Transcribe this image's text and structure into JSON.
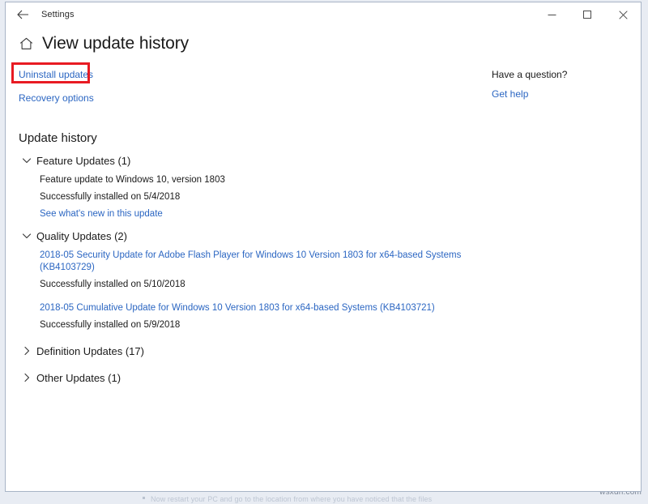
{
  "backdrop": {
    "cut_off_text": "Now restart your PC and go to the location from where you have noticed that the files",
    "watermark": "wsxdn.com"
  },
  "window": {
    "title": "Settings",
    "back_icon": "back-arrow-icon",
    "controls": {
      "minimize": "minimize-icon",
      "maximize": "maximize-icon",
      "close": "close-icon"
    }
  },
  "header": {
    "home_icon": "home-icon",
    "page_title": "View update history"
  },
  "actions": {
    "uninstall_updates": "Uninstall updates",
    "recovery_options": "Recovery options",
    "highlight_color": "#e81b23"
  },
  "help": {
    "heading": "Have a question?",
    "link": "Get help"
  },
  "update_history": {
    "section_title": "Update history",
    "link_color": "#2b66c2",
    "groups": [
      {
        "label": "Feature Updates (1)",
        "expanded": true,
        "chevron": "chevron-down-icon",
        "entries": [
          {
            "name": "Feature update to Windows 10, version 1803",
            "is_link": false,
            "status": "Successfully installed on 5/4/2018",
            "sublink": "See what's new in this update"
          }
        ]
      },
      {
        "label": "Quality Updates (2)",
        "expanded": true,
        "chevron": "chevron-down-icon",
        "entries": [
          {
            "name": "2018-05 Security Update for Adobe Flash Player for Windows 10 Version 1803 for x64-based Systems (KB4103729)",
            "is_link": true,
            "status": "Successfully installed on 5/10/2018",
            "sublink": ""
          },
          {
            "name": "2018-05 Cumulative Update for Windows 10 Version 1803 for x64-based Systems (KB4103721)",
            "is_link": true,
            "status": "Successfully installed on 5/9/2018",
            "sublink": ""
          }
        ]
      },
      {
        "label": "Definition Updates (17)",
        "expanded": false,
        "chevron": "chevron-right-icon",
        "entries": []
      },
      {
        "label": "Other Updates (1)",
        "expanded": false,
        "chevron": "chevron-right-icon",
        "entries": []
      }
    ]
  }
}
